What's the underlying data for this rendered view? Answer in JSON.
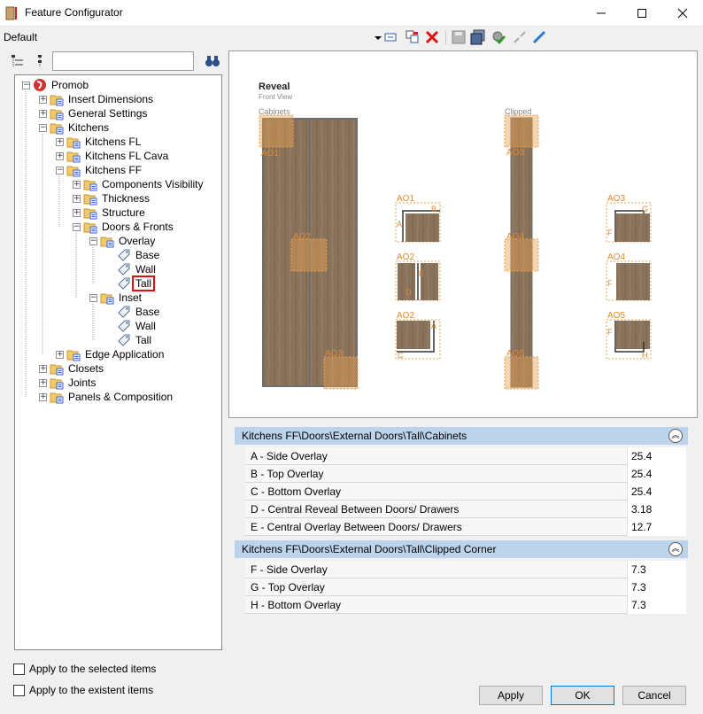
{
  "window": {
    "title": "Feature Configurator"
  },
  "toolbar": {
    "profile": "Default"
  },
  "search": {
    "value": "",
    "placeholder": ""
  },
  "tree": {
    "nodes": [
      {
        "label": "Promob"
      },
      {
        "label": "Insert Dimensions"
      },
      {
        "label": "General Settings"
      },
      {
        "label": "Kitchens"
      },
      {
        "label": "Kitchens FL"
      },
      {
        "label": "Kitchens FL Cava"
      },
      {
        "label": "Kitchens FF"
      },
      {
        "label": "Components Visibility"
      },
      {
        "label": "Thickness"
      },
      {
        "label": "Structure"
      },
      {
        "label": "Doors & Fronts"
      },
      {
        "label": "Overlay"
      },
      {
        "label": "Base"
      },
      {
        "label": "Wall"
      },
      {
        "label": "Tall"
      },
      {
        "label": "Inset"
      },
      {
        "label": "Base"
      },
      {
        "label": "Wall"
      },
      {
        "label": "Tall"
      },
      {
        "label": "Edge Application"
      },
      {
        "label": "Closets"
      },
      {
        "label": "Joints"
      },
      {
        "label": "Panels & Composition"
      }
    ]
  },
  "options": {
    "apply_selected": "Apply to the selected items",
    "apply_existent": "Apply to the existent items"
  },
  "preview": {
    "title": "Reveal",
    "subtitle": "Front View",
    "cabinets_label": "Cabinets",
    "clipped_label": "Clipped",
    "tags": {
      "ao1": "AO1",
      "ao2": "AO2",
      "ao3": "AO3",
      "ao4": "AO4",
      "ao5": "AO5",
      "a": "A",
      "b": "B",
      "c": "C",
      "d": "D",
      "e": "E",
      "f": "F",
      "g": "G",
      "h": "H"
    }
  },
  "sections": [
    {
      "title": "Kitchens FF\\Doors\\External Doors\\Tall\\Cabinets",
      "rows": [
        {
          "name": "A - Side Overlay",
          "value": "25.4"
        },
        {
          "name": "B - Top Overlay",
          "value": "25.4"
        },
        {
          "name": "C - Bottom Overlay",
          "value": "25.4"
        },
        {
          "name": "D - Central Reveal Between Doors/ Drawers",
          "value": "3.18"
        },
        {
          "name": "E - Central Overlay Between Doors/ Drawers",
          "value": "12.7"
        }
      ]
    },
    {
      "title": "Kitchens FF\\Doors\\External Doors\\Tall\\Clipped Corner",
      "rows": [
        {
          "name": "F - Side Overlay",
          "value": "7.3"
        },
        {
          "name": "G - Top Overlay",
          "value": "7.3"
        },
        {
          "name": "H - Bottom Overlay",
          "value": "7.3"
        }
      ]
    }
  ],
  "buttons": {
    "apply": "Apply",
    "ok": "OK",
    "cancel": "Cancel"
  },
  "colors": {
    "accent_orange": "#e8a050",
    "header_blue": "#bcd3ec",
    "wood": "#8a735c",
    "selection_red": "#e01010"
  }
}
